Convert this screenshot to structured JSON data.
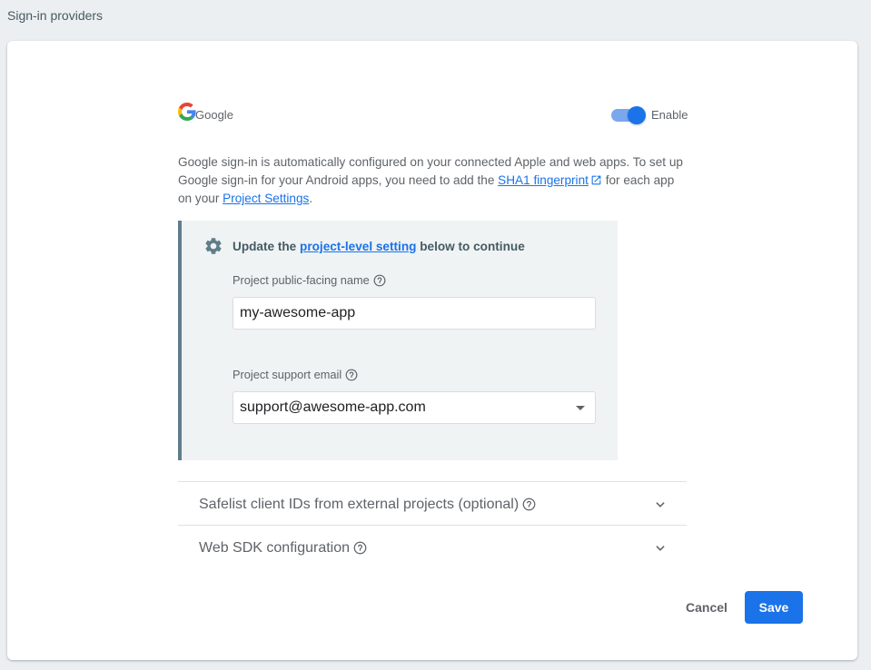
{
  "header": {
    "title": "Sign-in providers"
  },
  "provider": {
    "name": "Google",
    "enabled": true,
    "enable_label": "Enable"
  },
  "description": {
    "part1": "Google sign-in is automatically configured on your connected Apple and web apps. To set up Google sign-in for your Android apps, you need to add the ",
    "sha1_link": "SHA1 fingerprint",
    "part2": " for each app on your ",
    "settings_link": "Project Settings",
    "part3": "."
  },
  "notice": {
    "title_prefix": "Update the ",
    "title_link": "project-level setting",
    "title_suffix": " below to continue",
    "public_name_label": "Project public-facing name",
    "public_name_value": "my-awesome-app",
    "support_email_label": "Project support email",
    "support_email_value": "support@awesome-app.com"
  },
  "sections": [
    {
      "title": "Safelist client IDs from external projects (optional)"
    },
    {
      "title": "Web SDK configuration"
    }
  ],
  "actions": {
    "cancel": "Cancel",
    "save": "Save"
  },
  "colors": {
    "accent": "#1a73e8",
    "notice_bg": "#eff3f4",
    "notice_border": "#607d8b"
  }
}
